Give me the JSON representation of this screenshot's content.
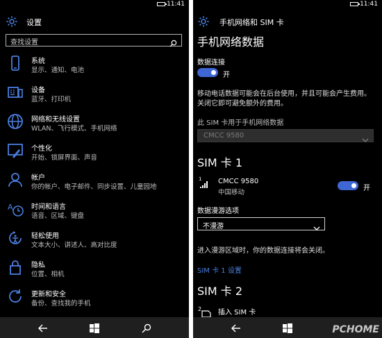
{
  "left": {
    "status": {
      "time": "11:41"
    },
    "header": {
      "title": "设置"
    },
    "search": {
      "placeholder": "查找设置"
    },
    "items": [
      {
        "title": "系统",
        "subtitle": "显示、通知、电池",
        "icon": "monitor-icon"
      },
      {
        "title": "设备",
        "subtitle": "蓝牙、打印机",
        "icon": "devices-icon"
      },
      {
        "title": "网络和无线设置",
        "subtitle": "WLAN、飞行模式、手机网络",
        "icon": "globe-icon"
      },
      {
        "title": "个性化",
        "subtitle": "开始、锁屏界面、声音",
        "icon": "personalization-icon"
      },
      {
        "title": "帐户",
        "subtitle": "你的帐户、电子邮件、同步设置、儿童园地",
        "icon": "person-icon"
      },
      {
        "title": "时间和语言",
        "subtitle": "语音、区域、键盘",
        "icon": "time-language-icon"
      },
      {
        "title": "轻松使用",
        "subtitle": "文本大小、讲述人、高对比度",
        "icon": "ease-of-access-icon"
      },
      {
        "title": "隐私",
        "subtitle": "位置、相机",
        "icon": "lock-icon"
      },
      {
        "title": "更新和安全",
        "subtitle": "备份、查找我的手机",
        "icon": "update-icon"
      }
    ]
  },
  "right": {
    "status": {
      "time": "11:41"
    },
    "header": {
      "title": "手机网络和 SIM 卡"
    },
    "section_title": "手机网络数据",
    "data_connection": {
      "label": "数据连接",
      "state": "开"
    },
    "info_text_1": "移动电话数据可能会在后台使用，并且可能会产生费用。",
    "info_text_2": "关闭它即可避免额外的费用。",
    "sim_for_data": {
      "label": "此 SIM 卡用于手机网络数据",
      "value": "CMCC 9580"
    },
    "sim1": {
      "title": "SIM 卡 1",
      "name": "CMCC 9580",
      "carrier": "中国移动",
      "toggle_state": "开",
      "signal_num": "1"
    },
    "roaming": {
      "label": "数据漫游选项",
      "value": "不漫游",
      "note": "进入漫游区域时，你的数据连接将会关闭。"
    },
    "sim1_settings_link": "SIM 卡 1 设置",
    "sim2": {
      "title": "SIM 卡 2",
      "insert": "插入 SIM 卡",
      "slot_num": "2"
    }
  },
  "watermark": "PCHOME",
  "colors": {
    "accent": "#3f67d4",
    "link": "#4a7fe0",
    "background": "#000000"
  }
}
